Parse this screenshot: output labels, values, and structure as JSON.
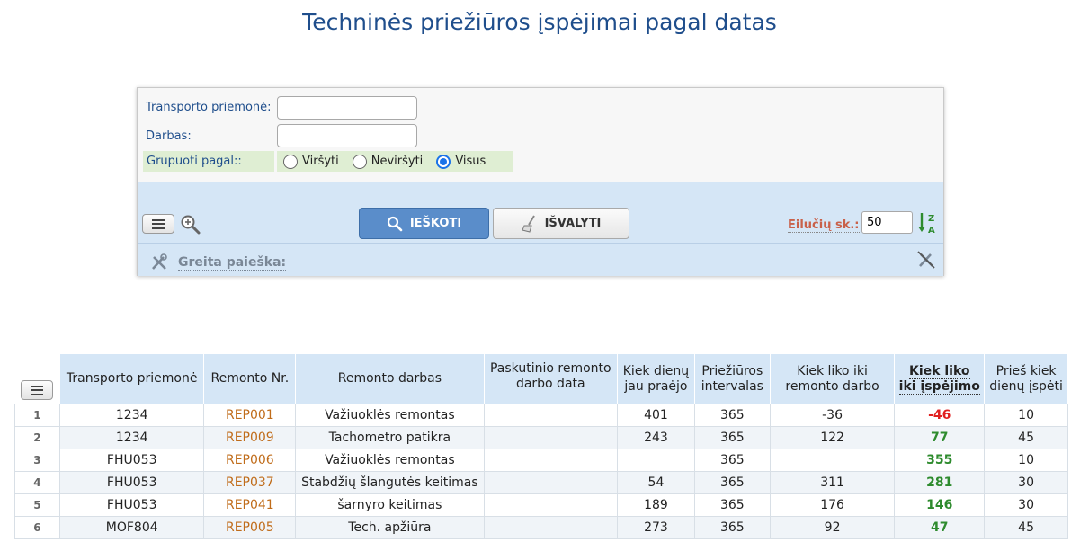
{
  "page": {
    "title": "Techninės priežiūros įspėjimai pagal datas"
  },
  "filters": {
    "vehicle_label": "Transporto priemonė:",
    "vehicle_value": "",
    "work_label": "Darbas:",
    "work_value": "",
    "group_label": "Grupuoti pagal::",
    "group_options": [
      "Viršyti",
      "Neviršyti",
      "Visus"
    ],
    "group_selected": "Visus"
  },
  "toolbar": {
    "search_label": "IEŠKOTI",
    "clear_label": "IŠVALYTI",
    "rows_label": "Eilučių sk.:",
    "rows_value": "50",
    "quick_search_label": "Greita paieška:"
  },
  "table": {
    "headers": [
      "Transporto priemonė",
      "Remonto Nr.",
      "Remonto darbas",
      "Paskutinio remonto darbo data",
      "Kiek dienų jau praėjo",
      "Priežiūros intervalas",
      "Kiek liko iki remonto darbo",
      "Kiek liko iki įspėjimo",
      "Prieš kiek dienų įspėti"
    ],
    "rows": [
      [
        "1",
        "1234",
        "REP001",
        "Važiuoklės remontas",
        "",
        "401",
        "365",
        "-36",
        "-46",
        "10"
      ],
      [
        "2",
        "1234",
        "REP009",
        "Tachometro patikra",
        "",
        "243",
        "365",
        "122",
        "77",
        "45"
      ],
      [
        "3",
        "FHU053",
        "REP006",
        "Važiuoklės remontas",
        "",
        "",
        "365",
        "",
        "355",
        "10"
      ],
      [
        "4",
        "FHU053",
        "REP037",
        "Stabdžių šlangutės keitimas",
        "",
        "54",
        "365",
        "311",
        "281",
        "30"
      ],
      [
        "5",
        "FHU053",
        "REP041",
        "šarnyro keitimas",
        "",
        "189",
        "365",
        "176",
        "146",
        "30"
      ],
      [
        "6",
        "MOF804",
        "REP005",
        "Tech. apžiūra",
        "",
        "273",
        "365",
        "92",
        "47",
        "45"
      ]
    ]
  },
  "colors": {
    "title": "#1f4e8c",
    "accent": "#5a8dca",
    "panel": "#d5e6f6",
    "negative": "#e02020",
    "positive": "#2e8b2e",
    "link": "#c06c1a"
  }
}
